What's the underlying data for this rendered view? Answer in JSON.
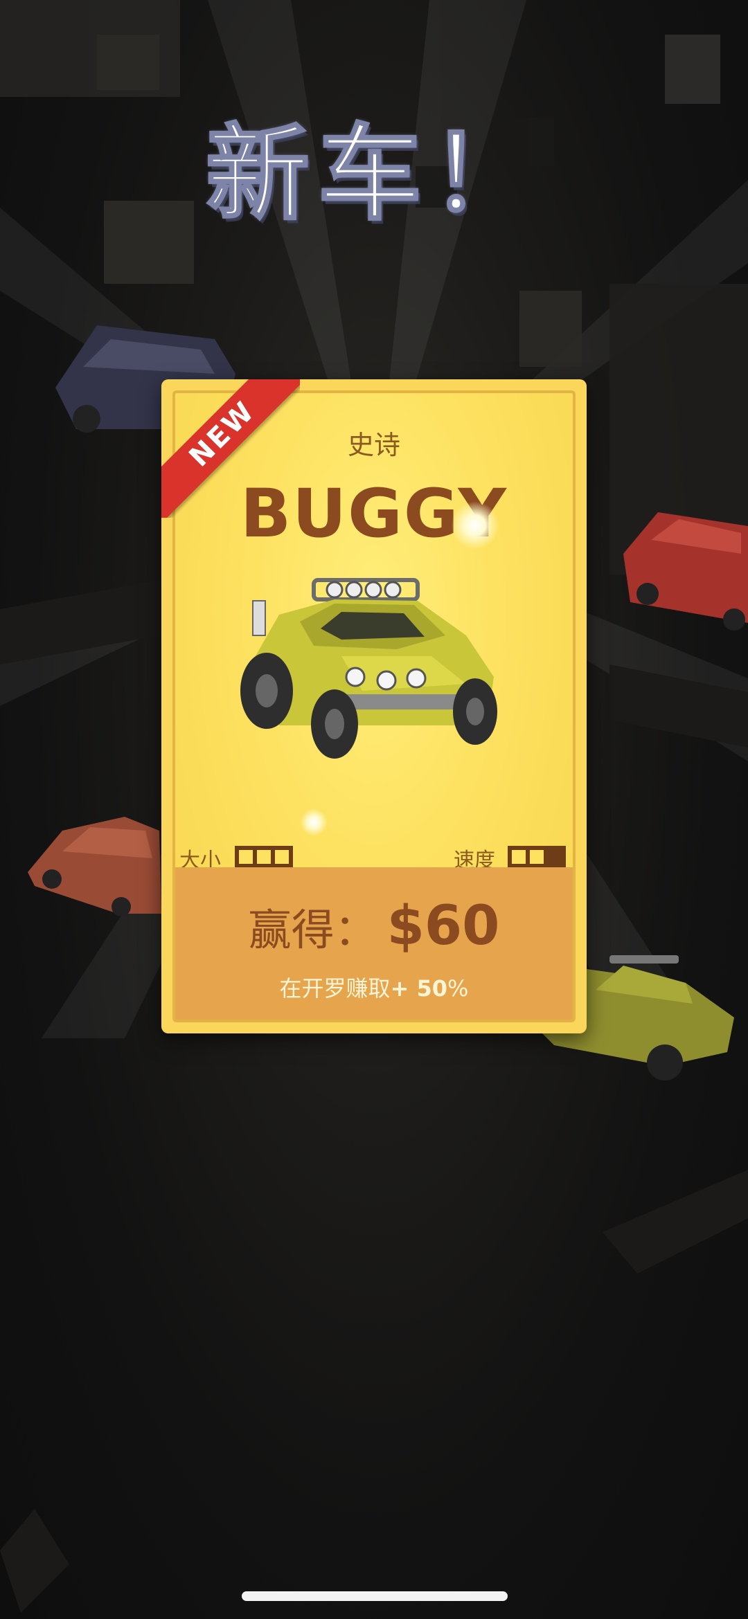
{
  "header": {
    "title": "新车！"
  },
  "card": {
    "badge": "NEW",
    "rarity": "史诗",
    "car_name": "BUGGY",
    "stats": {
      "size_label": "大小",
      "size_level": 3,
      "size_max": 3,
      "speed_label": "速度",
      "speed_level": 2,
      "speed_max": 3
    },
    "reward": {
      "label": "赢得：",
      "amount": "$60",
      "bonus_text": "在开罗赚取",
      "bonus_value": "+ 50",
      "bonus_suffix": "%"
    }
  },
  "colors": {
    "card_yellow": "#fad75a",
    "reward_orange": "#e6a54d",
    "text_brown": "#8b4a1f",
    "badge_red": "#d9332b"
  }
}
